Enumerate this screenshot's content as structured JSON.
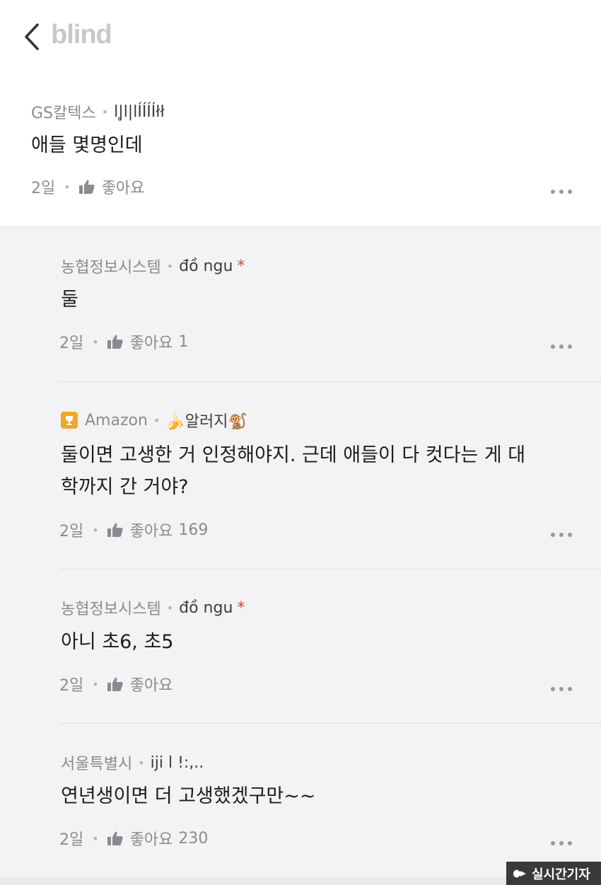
{
  "header": {
    "logo": "blind"
  },
  "comments": [
    {
      "company": "GS칼텍스",
      "nickname": "l|̥l|lÍÍÍÍłł",
      "text": "애들 몇명인데",
      "time": "2일",
      "like_label": "좋아요",
      "like_count": ""
    }
  ],
  "replies": [
    {
      "company": "농협정보시스템",
      "nickname": "đồ ngu",
      "author_mark": "*",
      "text_lines": [
        "둘"
      ],
      "time": "2일",
      "like_label": "좋아요",
      "like_count": "1"
    },
    {
      "company": "Amazon",
      "nickname": "🍌알러지🐒",
      "text_lines": [
        "둘이면 고생한 거 인정해야지. 근데 애들이 다 컷다는 게 대",
        "학까지 간 거야?"
      ],
      "time": "2일",
      "like_label": "좋아요",
      "like_count": "169"
    },
    {
      "company": "농협정보시스템",
      "nickname": "đồ ngu",
      "author_mark": "*",
      "text_lines": [
        "아니 초6, 초5"
      ],
      "time": "2일",
      "like_label": "좋아요",
      "like_count": ""
    },
    {
      "company": "서울특별시",
      "nickname": "iji l !:,..",
      "text_lines": [
        "연년생이면 더 고생했겠구만~~"
      ],
      "time": "2일",
      "like_label": "좋아요",
      "like_count": "230"
    }
  ],
  "watermark": {
    "text": "실시간기자"
  },
  "colors": {
    "author_mark": "#d9433b",
    "badge": "#f2a72a",
    "logo": "#c8c8c8"
  },
  "icons": {
    "back": "chevron-left-icon",
    "like": "thumbs-up-icon",
    "more": "more-horizontal-icon",
    "badge": "trophy-icon"
  }
}
